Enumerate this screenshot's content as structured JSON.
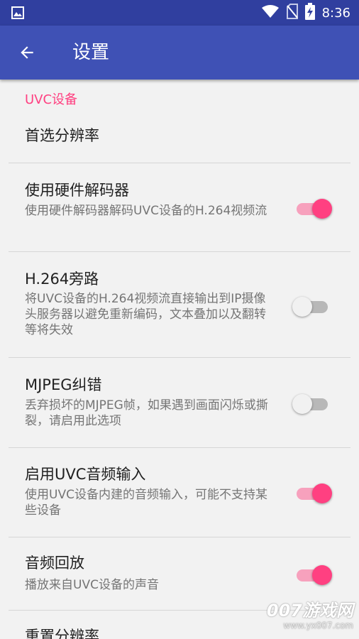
{
  "status_bar": {
    "time": "8:36",
    "icons": [
      "image-icon",
      "wifi-icon",
      "no-sim-icon",
      "battery-charging-icon"
    ]
  },
  "app_bar": {
    "title": "设置",
    "back_icon": "arrow-back-icon"
  },
  "category": {
    "label": "UVC设备"
  },
  "preferences": [
    {
      "title": "首选分辨率",
      "summary": "",
      "switch": null
    },
    {
      "title": "使用硬件解码器",
      "summary": "使用硬件解码器解码UVC设备的H.264视频流",
      "switch": true
    },
    {
      "title": "H.264旁路",
      "summary": "将UVC设备的H.264视频流直接输出到IP摄像头服务器以避免重新编码，文本叠加以及翻转等将失效",
      "switch": false
    },
    {
      "title": "MJPEG纠错",
      "summary": "丢弃损坏的MJPEG帧，如果遇到画面闪烁或撕裂，请启用此选项",
      "switch": false
    },
    {
      "title": "启用UVC音频输入",
      "summary": "使用UVC设备内建的音频输入，可能不支持某些设备",
      "switch": true
    },
    {
      "title": "音频回放",
      "summary": "播放来自UVC设备的声音",
      "switch": true
    },
    {
      "title": "重置分辨率",
      "summary": "",
      "switch": null
    }
  ],
  "watermark": {
    "brand": "007游戏网",
    "url": "www.yx007.com"
  },
  "colors": {
    "primary": "#3f51b5",
    "primary_dark": "#303f9f",
    "accent": "#ff4081",
    "switch_on_track": "#f7a1bd",
    "switch_off_track": "#b8b8b8",
    "switch_off_thumb": "#f1f1f1"
  }
}
